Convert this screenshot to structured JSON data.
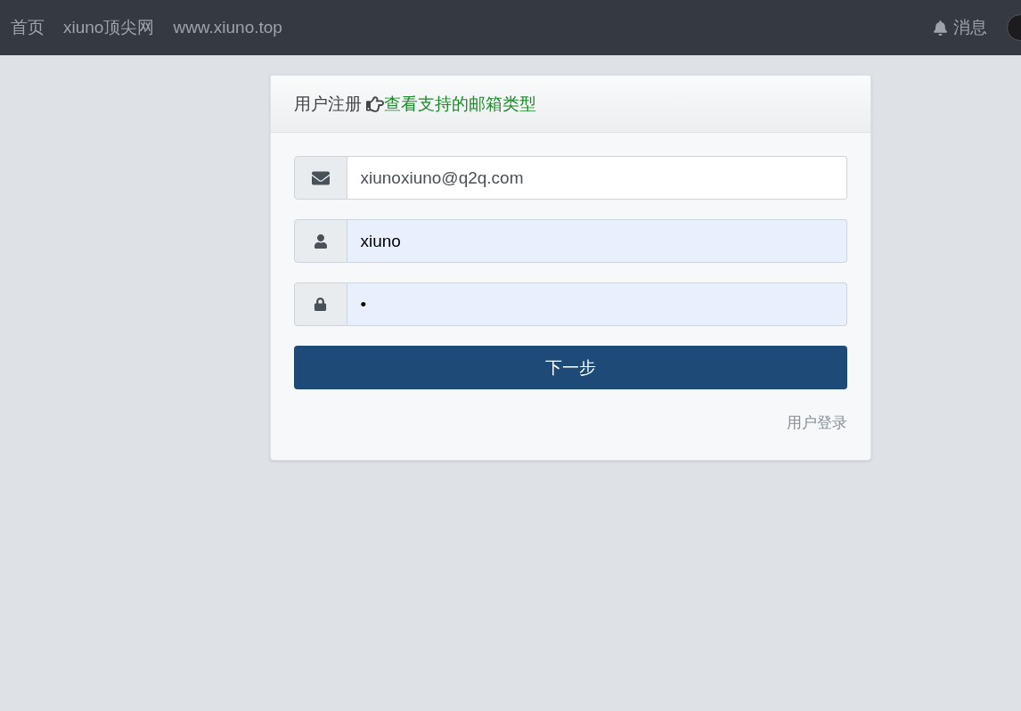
{
  "navbar": {
    "links": [
      {
        "label": "首页"
      },
      {
        "label": "xiuno顶尖网"
      },
      {
        "label": "www.xiuno.top"
      }
    ],
    "messages": {
      "label": "消息"
    }
  },
  "card": {
    "title": "用户注册",
    "link": "查看支持的邮箱类型",
    "fields": [
      {
        "kind": "email",
        "value": "xiunoxiuno@q2q.com",
        "autofilled": false
      },
      {
        "kind": "user",
        "value": "xiuno",
        "autofilled": true
      },
      {
        "kind": "password",
        "value": "•",
        "autofilled": true
      }
    ],
    "submit": "下一步",
    "login_link": "用户登录"
  }
}
